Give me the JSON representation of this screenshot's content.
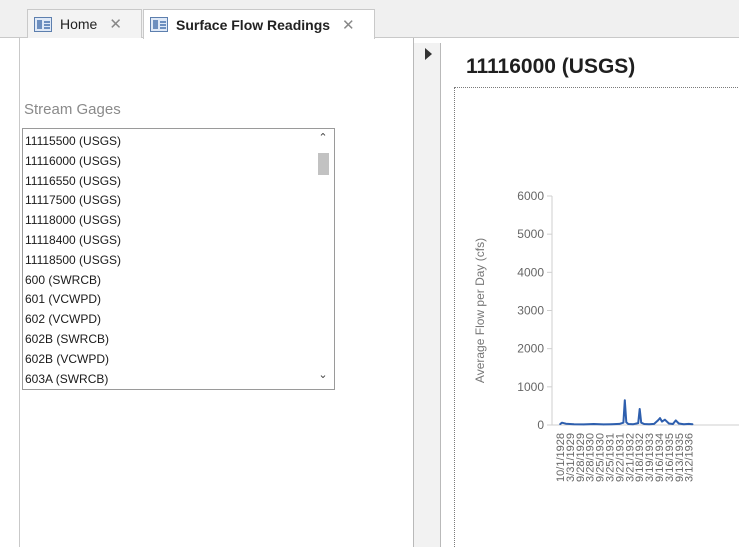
{
  "tabs": [
    {
      "label": "Home"
    },
    {
      "label": "Surface Flow Readings"
    }
  ],
  "form": {
    "list_label": "Stream Gages",
    "gages": [
      "11115500 (USGS)",
      "11116000 (USGS)",
      "11116550 (USGS)",
      "11117500 (USGS)",
      "11118000 (USGS)",
      "11118400 (USGS)",
      "11118500 (USGS)",
      "600 (SWRCB)",
      "601 (VCWPD)",
      "602 (VCWPD)",
      "602B (SWRCB)",
      "602B (VCWPD)",
      "603A (SWRCB)"
    ]
  },
  "subform": {
    "title": "11116000 (USGS)"
  },
  "chart_data": {
    "type": "line",
    "title": "11116000 (USGS)",
    "ylabel": "Average Flow per Day (cfs)",
    "xlabel": "",
    "ylim": [
      0,
      6000
    ],
    "yticks": [
      0,
      1000,
      2000,
      3000,
      4000,
      5000,
      6000
    ],
    "categories": [
      "10/1/1928",
      "3/31/1929",
      "9/28/1929",
      "3/28/1930",
      "9/25/1930",
      "3/25/1931",
      "9/22/1931",
      "3/21/1932",
      "9/18/1932",
      "3/19/1933",
      "9/16/1934",
      "3/16/1935",
      "9/13/1935",
      "3/12/1936"
    ],
    "series": [
      {
        "color": "#2e5fae",
        "x": [
          0,
          0.2,
          0.6,
          1.4,
          2.4,
          3.4,
          4.4,
          5.2,
          6.0,
          6.4,
          6.55,
          6.7,
          6.9,
          7.4,
          7.9,
          8.05,
          8.2,
          8.5,
          9.0,
          9.5,
          9.9,
          10.1,
          10.3,
          10.6,
          11.0,
          11.4,
          11.7,
          12.0,
          12.5,
          13.0,
          13.4
        ],
        "values": [
          20,
          60,
          35,
          20,
          15,
          25,
          15,
          20,
          30,
          60,
          650,
          70,
          25,
          20,
          50,
          420,
          60,
          25,
          20,
          30,
          120,
          180,
          90,
          140,
          40,
          25,
          120,
          40,
          20,
          30,
          20
        ]
      }
    ]
  }
}
